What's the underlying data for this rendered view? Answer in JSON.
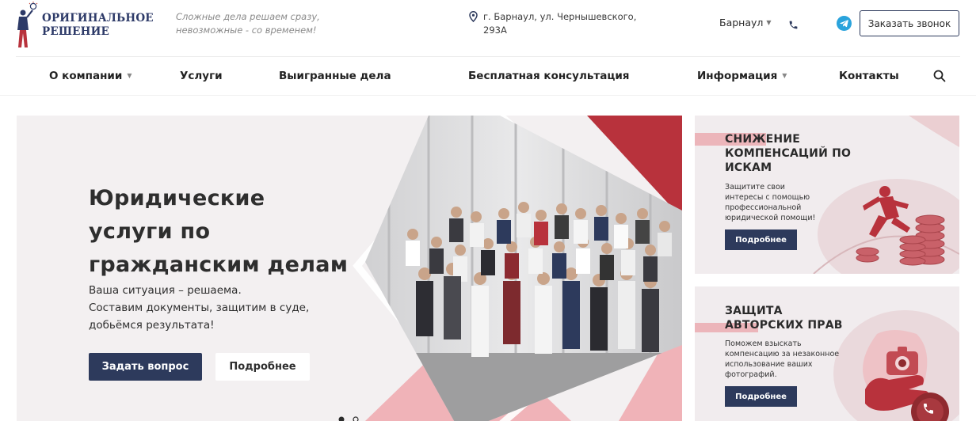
{
  "header": {
    "logo_line1": "ОРИГИНАЛЬНОЕ",
    "logo_line2": "РЕШЕНИЕ",
    "slogan_line1": "Сложные дела решаем сразу,",
    "slogan_line2": "невозможные - со временем!",
    "address_line1": "г. Барнаул, ул. Чернышевского,",
    "address_line2": "293А",
    "city": "Барнаул",
    "call_button": "Заказать звонок",
    "icons": [
      "location-pin-icon",
      "chevron-down-icon",
      "phone-icon",
      "telegram-icon"
    ]
  },
  "nav": {
    "items": [
      {
        "label": "О компании",
        "has_dropdown": true
      },
      {
        "label": "Услуги",
        "has_dropdown": false
      },
      {
        "label": "Выигранные дела",
        "has_dropdown": false
      },
      {
        "label": "Бесплатная консультация",
        "has_dropdown": false
      },
      {
        "label": "Информация",
        "has_dropdown": true
      },
      {
        "label": "Контакты",
        "has_dropdown": false
      }
    ],
    "search_icon": "search-icon"
  },
  "hero": {
    "title_line1": "Юридические",
    "title_line2": "услуги по",
    "title_line3": "гражданским делам",
    "sub_line1": "Ваша ситуация – решаема.",
    "sub_line2": "Составим документы, защитим в суде,",
    "sub_line3": "добьёмся результата!",
    "primary_button": "Задать вопрос",
    "secondary_button": "Подробнее",
    "slide_dots": 2,
    "active_dot": 1
  },
  "cards": [
    {
      "title_line1": "СНИЖЕНИЕ",
      "title_line2": "КОМПЕНСАЦИЙ ПО",
      "title_line3": "ИСКАМ",
      "desc_line1": "Защитите свои",
      "desc_line2": "интересы с помощью",
      "desc_line3": "профессиональной",
      "desc_line4": "юридической помощи!",
      "button": "Подробнее"
    },
    {
      "title_line1": "ЗАЩИТА",
      "title_line2": "АВТОРСКИХ ПРАВ",
      "desc_line1": "Поможем взыскать",
      "desc_line2": "компенсацию за незаконное",
      "desc_line3": "использование ваших",
      "desc_line4": "фотографий.",
      "button": "Подробнее"
    }
  ],
  "colors": {
    "brand_navy": "#2d3a5c",
    "accent_red": "#b8323c",
    "accent_pink": "#f0b3b8",
    "telegram_blue": "#2aa3dc",
    "floating_call": "#8f2a2f"
  }
}
